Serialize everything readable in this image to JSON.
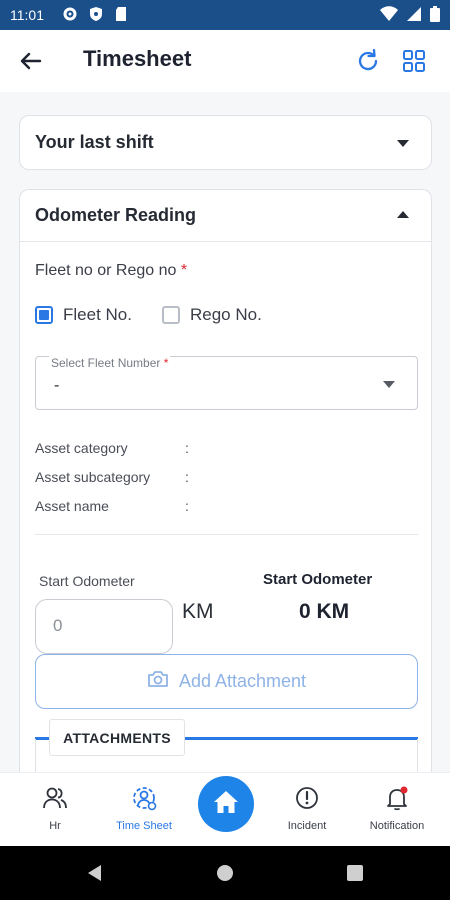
{
  "status_bar": {
    "time": "11:01"
  },
  "app_bar": {
    "title": "Timesheet"
  },
  "shift_section": {
    "title": "Your last shift"
  },
  "odometer_section": {
    "title": "Odometer Reading",
    "fleet_label": "Fleet no or Rego no",
    "required_mark": "*",
    "options": [
      {
        "label": "Fleet No.",
        "checked": true
      },
      {
        "label": "Rego No.",
        "checked": false
      }
    ],
    "select_fleet": {
      "label": "Select Fleet Number",
      "value": "-"
    },
    "asset_info": [
      {
        "label": "Asset category",
        "value": ":"
      },
      {
        "label": "Asset subcategory",
        "value": ":"
      },
      {
        "label": "Asset name",
        "value": ":"
      }
    ],
    "start_odometer": {
      "input_label": "Start Odometer",
      "input_value": "0",
      "unit": "KM",
      "summary_label": "Start Odometer",
      "summary_value": "0 KM"
    },
    "attachment_button": "Add Attachment",
    "attachments_tab": "ATTACHMENTS"
  },
  "bottom_nav": {
    "items": [
      {
        "label": "Hr",
        "icon": "people-icon"
      },
      {
        "label": "Time Sheet",
        "icon": "timesheet-user-icon",
        "active": true
      },
      {
        "label": "Home",
        "icon": "home-icon"
      },
      {
        "label": "Incident",
        "icon": "incident-icon"
      },
      {
        "label": "Notification",
        "icon": "bell-icon",
        "badge": true
      }
    ]
  },
  "colors": {
    "accent": "#2a78e4",
    "status_bar": "#1a4f8a",
    "required": "#e0262f"
  }
}
